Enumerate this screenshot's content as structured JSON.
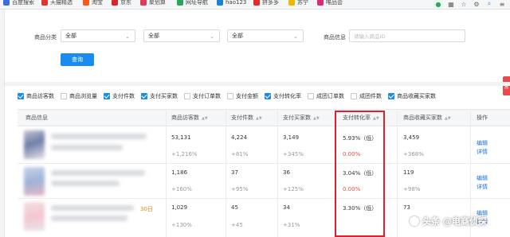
{
  "bookmarks": [
    {
      "label": "百度搜索",
      "color": "#3b6fd6"
    },
    {
      "label": "天猫精选",
      "color": "#e0352b"
    },
    {
      "label": "淘宝",
      "color": "#f55a1f"
    },
    {
      "label": "京东",
      "color": "#d8262c"
    },
    {
      "label": "聚划算",
      "color": "#e23a59"
    },
    {
      "label": "网址导航",
      "color": "#2aa65a"
    },
    {
      "label": "hao123",
      "color": "#1e80d6"
    },
    {
      "label": "拼多多",
      "color": "#e12c2c"
    },
    {
      "label": "苏宁",
      "color": "#f2b705"
    },
    {
      "label": "唯品会",
      "color": "#d92b7a"
    }
  ],
  "filters": {
    "category_label": "商品分类",
    "select1": "全部",
    "select2": "全部",
    "select3": "全部",
    "info_label": "商品信息",
    "info_placeholder": "请输入商品ID",
    "query_button": "查询"
  },
  "metrics": [
    {
      "label": "商品访客数",
      "checked": true
    },
    {
      "label": "商品浏览量",
      "checked": false
    },
    {
      "label": "支付件数",
      "checked": true
    },
    {
      "label": "支付买家数",
      "checked": true
    },
    {
      "label": "支付订单数",
      "checked": false
    },
    {
      "label": "支付金额",
      "checked": false
    },
    {
      "label": "支付转化率",
      "checked": true
    },
    {
      "label": "成团订单数",
      "checked": false
    },
    {
      "label": "成团件数",
      "checked": false
    },
    {
      "label": "商品收藏买家数",
      "checked": true
    }
  ],
  "table": {
    "headers": [
      "商品信息",
      "商品访客数",
      "支付件数",
      "支付买家数",
      "支付转化率",
      "商品收藏买家数",
      "操作"
    ],
    "rows": [
      {
        "visitors": "53,131",
        "visitors_delta": "+1,216%",
        "pieces": "4,224",
        "pieces_delta": "+81%",
        "buyers": "3,149",
        "buyers_delta": "+345%",
        "conv": "5.93%（低）",
        "conv_delta": "0.00%",
        "fav": "3,459",
        "fav_delta": "+368%",
        "edit": "编辑",
        "detail": "详情"
      },
      {
        "visitors": "1,186",
        "visitors_delta": "+160%",
        "pieces": "37",
        "pieces_delta": "+95%",
        "buyers": "36",
        "buyers_delta": "+125%",
        "conv": "3.04%（低）",
        "conv_delta": "0.00%",
        "fav": "119",
        "fav_delta": "+98%",
        "edit": "编辑",
        "detail": "详情"
      },
      {
        "visitors": "1,029",
        "visitors_delta": "+130%",
        "pieces": "45",
        "pieces_delta": "+45",
        "buyers": "34",
        "buyers_delta": "+31%",
        "conv": "3.30%（低）",
        "conv_delta": "",
        "fav": "73",
        "fav_delta": "",
        "edit": "编辑",
        "detail": "详情",
        "tag": "30日"
      }
    ]
  },
  "edge_tab": "营",
  "watermark": "头条 @电商侦探",
  "colors": {
    "accent": "#1a8cf0",
    "highlight": "#e0202a",
    "negative": "#f04848"
  }
}
